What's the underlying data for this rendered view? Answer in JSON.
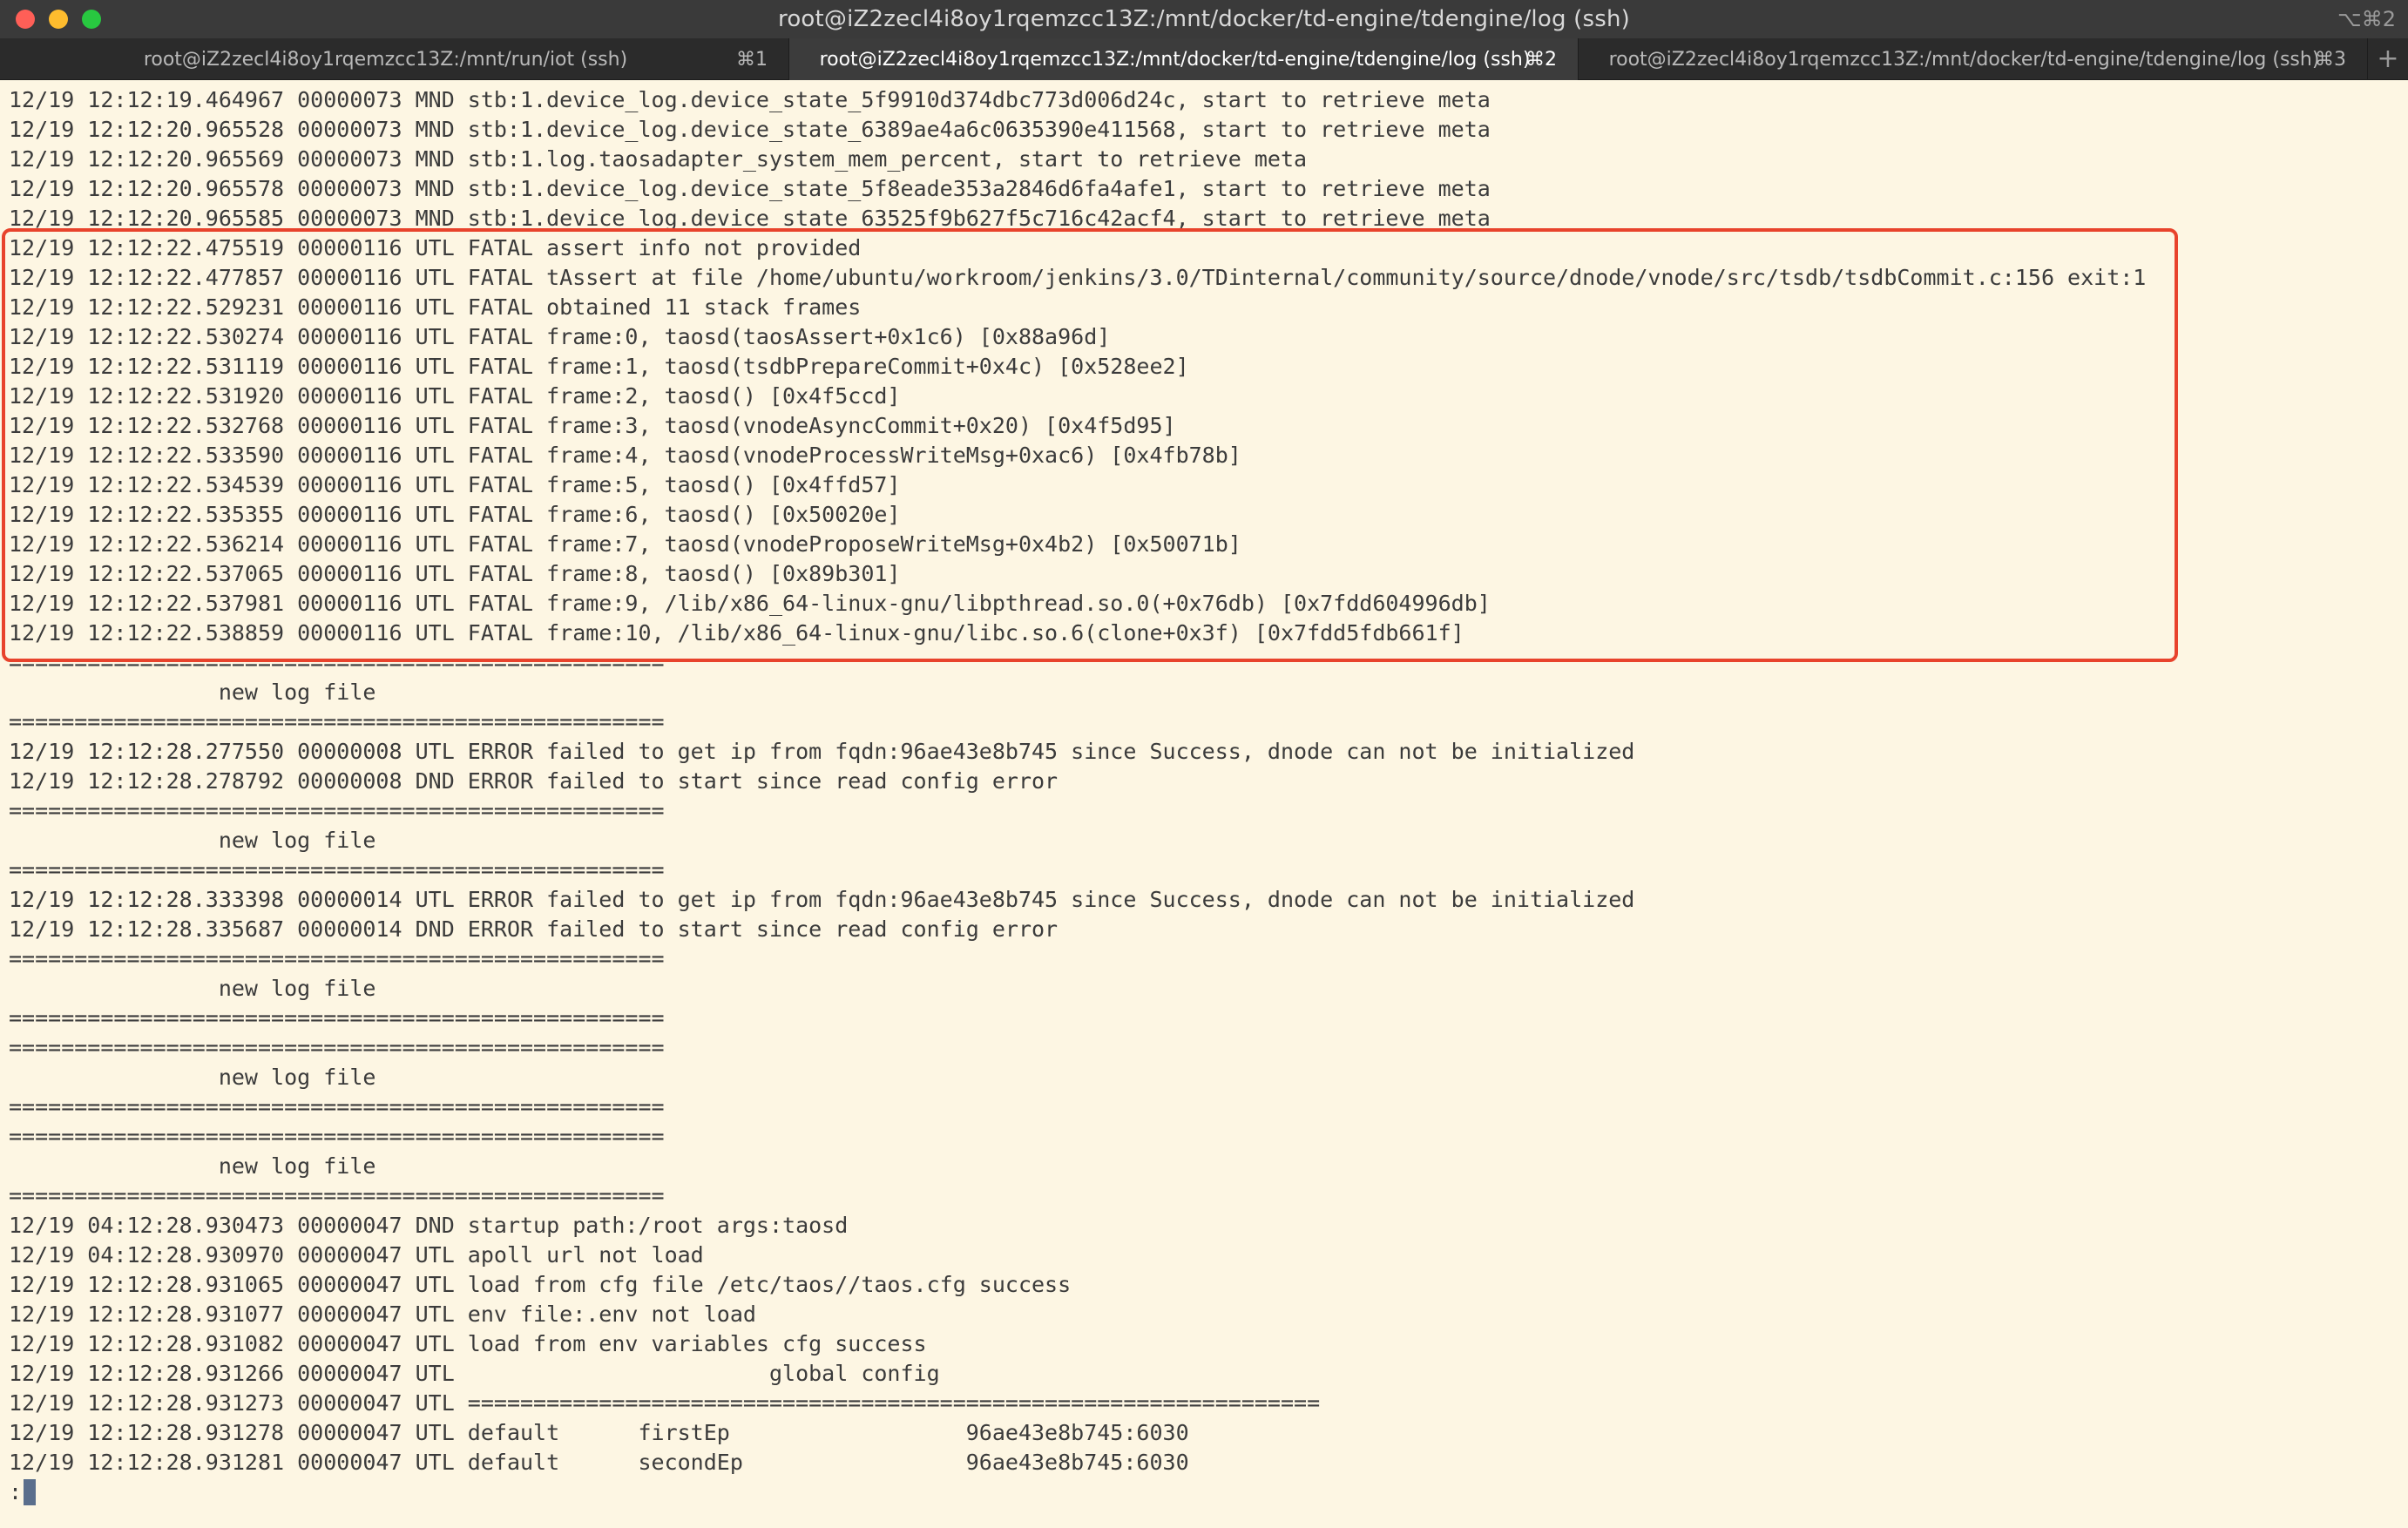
{
  "window": {
    "title": "root@iZ2zecl4i8oy1rqemzcc13Z:/mnt/docker/td-engine/tdengine/log (ssh)",
    "shortcut": "⌥⌘2"
  },
  "tabs": [
    {
      "label": "root@iZ2zecl4i8oy1rqemzcc13Z:/mnt/run/iot (ssh)",
      "key": "⌘1"
    },
    {
      "label": "root@iZ2zecl4i8oy1rqemzcc13Z:/mnt/docker/td-engine/tdengine/log (ssh)",
      "key": "⌘2"
    },
    {
      "label": "root@iZ2zecl4i8oy1rqemzcc13Z:/mnt/docker/td-engine/tdengine/log (ssh)",
      "key": "⌘3"
    }
  ],
  "new_tab": "+",
  "lines": [
    "12/19 12:12:19.464967 00000073 MND stb:1.device_log.device_state_5f9910d374dbc773d006d24c, start to retrieve meta",
    "12/19 12:12:20.965528 00000073 MND stb:1.device_log.device_state_6389ae4a6c0635390e411568, start to retrieve meta",
    "12/19 12:12:20.965569 00000073 MND stb:1.log.taosadapter_system_mem_percent, start to retrieve meta",
    "12/19 12:12:20.965578 00000073 MND stb:1.device_log.device_state_5f8eade353a2846d6fa4afe1, start to retrieve meta",
    "12/19 12:12:20.965585 00000073 MND stb:1.device_log.device_state_63525f9b627f5c716c42acf4, start to retrieve meta",
    "12/19 12:12:22.475519 00000116 UTL FATAL assert info not provided",
    "12/19 12:12:22.477857 00000116 UTL FATAL tAssert at file /home/ubuntu/workroom/jenkins/3.0/TDinternal/community/source/dnode/vnode/src/tsdb/tsdbCommit.c:156 exit:1",
    "12/19 12:12:22.529231 00000116 UTL FATAL obtained 11 stack frames",
    "12/19 12:12:22.530274 00000116 UTL FATAL frame:0, taosd(taosAssert+0x1c6) [0x88a96d]",
    "12/19 12:12:22.531119 00000116 UTL FATAL frame:1, taosd(tsdbPrepareCommit+0x4c) [0x528ee2]",
    "12/19 12:12:22.531920 00000116 UTL FATAL frame:2, taosd() [0x4f5ccd]",
    "12/19 12:12:22.532768 00000116 UTL FATAL frame:3, taosd(vnodeAsyncCommit+0x20) [0x4f5d95]",
    "12/19 12:12:22.533590 00000116 UTL FATAL frame:4, taosd(vnodeProcessWriteMsg+0xac6) [0x4fb78b]",
    "12/19 12:12:22.534539 00000116 UTL FATAL frame:5, taosd() [0x4ffd57]",
    "12/19 12:12:22.535355 00000116 UTL FATAL frame:6, taosd() [0x50020e]",
    "12/19 12:12:22.536214 00000116 UTL FATAL frame:7, taosd(vnodeProposeWriteMsg+0x4b2) [0x50071b]",
    "12/19 12:12:22.537065 00000116 UTL FATAL frame:8, taosd() [0x89b301]",
    "12/19 12:12:22.537981 00000116 UTL FATAL frame:9, /lib/x86_64-linux-gnu/libpthread.so.0(+0x76db) [0x7fdd604996db]",
    "12/19 12:12:22.538859 00000116 UTL FATAL frame:10, /lib/x86_64-linux-gnu/libc.so.6(clone+0x3f) [0x7fdd5fdb661f]",
    "==================================================",
    "                new log file",
    "==================================================",
    "12/19 12:12:28.277550 00000008 UTL ERROR failed to get ip from fqdn:96ae43e8b745 since Success, dnode can not be initialized",
    "12/19 12:12:28.278792 00000008 DND ERROR failed to start since read config error",
    "==================================================",
    "                new log file",
    "==================================================",
    "12/19 12:12:28.333398 00000014 UTL ERROR failed to get ip from fqdn:96ae43e8b745 since Success, dnode can not be initialized",
    "12/19 12:12:28.335687 00000014 DND ERROR failed to start since read config error",
    "==================================================",
    "                new log file",
    "==================================================",
    "==================================================",
    "                new log file",
    "==================================================",
    "==================================================",
    "                new log file",
    "==================================================",
    "12/19 04:12:28.930473 00000047 DND startup path:/root args:taosd",
    "12/19 04:12:28.930970 00000047 UTL apoll url not load",
    "12/19 12:12:28.931065 00000047 UTL load from cfg file /etc/taos//taos.cfg success",
    "12/19 12:12:28.931077 00000047 UTL env file:.env not load",
    "12/19 12:12:28.931082 00000047 UTL load from env variables cfg success",
    "12/19 12:12:28.931266 00000047 UTL                        global config",
    "12/19 12:12:28.931273 00000047 UTL =================================================================",
    "12/19 12:12:28.931278 00000047 UTL default      firstEp                  96ae43e8b745:6030",
    "12/19 12:12:28.931281 00000047 UTL default      secondEp                 96ae43e8b745:6030"
  ],
  "prompt": ":"
}
